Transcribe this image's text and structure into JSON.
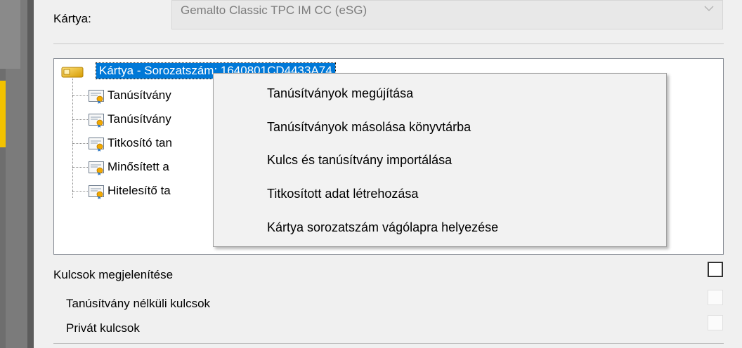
{
  "card": {
    "label": "Kártya:",
    "selected_value": "Gemalto Classic TPC IM CC (eSG)"
  },
  "tree": {
    "root_label": "Kártya - Sorozatszám: 1640801CD4433A74",
    "children": [
      {
        "label": "Tanúsítvány"
      },
      {
        "label": "Tanúsítvány"
      },
      {
        "label": "Titkosító tan"
      },
      {
        "label": "Minősített a"
      },
      {
        "label": "Hitelesítő ta"
      }
    ]
  },
  "context_menu": {
    "items": [
      {
        "label": "Tanúsítványok megújítása"
      },
      {
        "label": "Tanúsítványok másolása könyvtárba"
      },
      {
        "label": "Kulcs és tanúsítvány importálása"
      },
      {
        "label": "Titkosított adat létrehozása"
      },
      {
        "label": "Kártya sorozatszám vágólapra helyezése"
      }
    ]
  },
  "options": {
    "show_keys": {
      "label": "Kulcsok megjelenítése",
      "checked": false
    },
    "keys_without_cert": {
      "label": "Tanúsítvány nélküli kulcsok",
      "checked": false
    },
    "private_keys": {
      "label": "Privát kulcsok",
      "checked": false
    }
  },
  "colors": {
    "selection": "#0078d7",
    "accent_strip": "#f2c200",
    "menu_bg": "#f2f2f2"
  },
  "icons": {
    "root": "smart-card-chip-icon",
    "children": "certificate-icon",
    "select": "chevron-down-icon"
  }
}
